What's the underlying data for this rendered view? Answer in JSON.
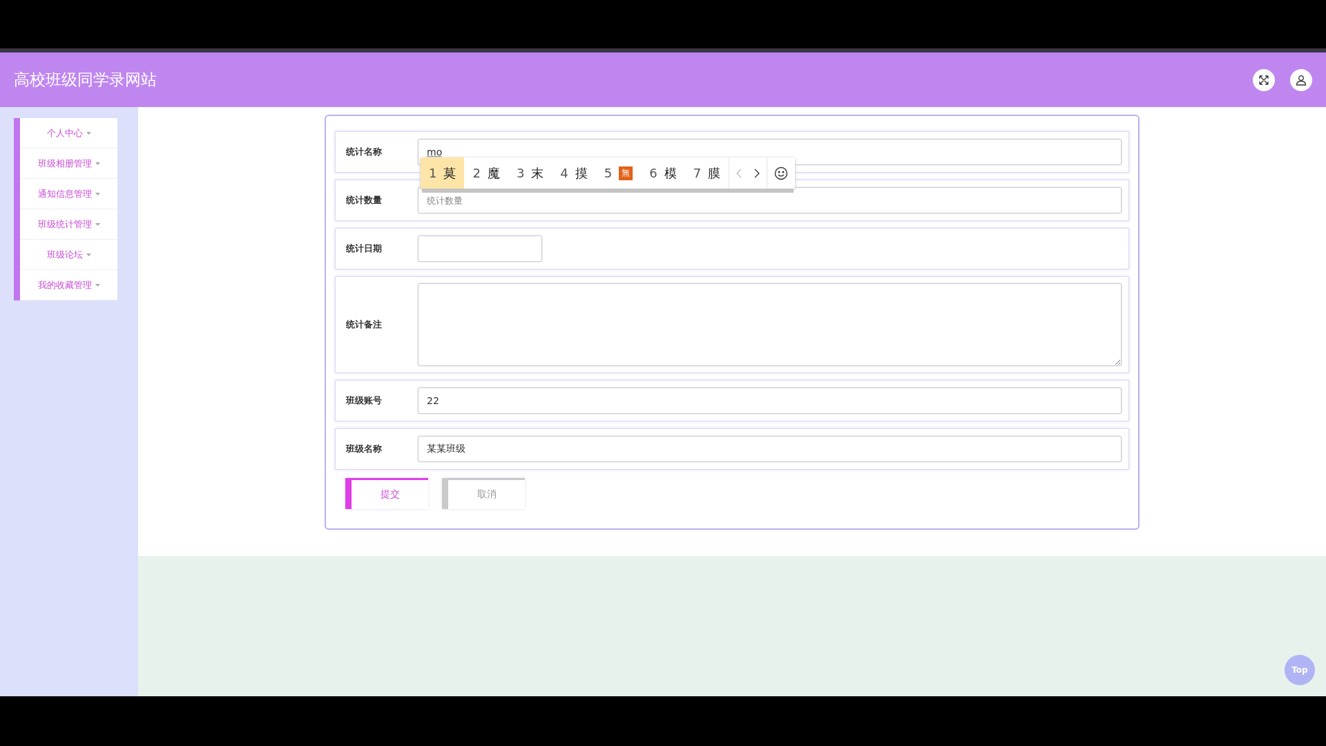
{
  "header": {
    "title": "高校班级同学录网站"
  },
  "sidebar": {
    "items": [
      {
        "label": "个人中心"
      },
      {
        "label": "班级相册管理"
      },
      {
        "label": "通知信息管理"
      },
      {
        "label": "班级统计管理"
      },
      {
        "label": "班级论坛"
      },
      {
        "label": "我的收藏管理"
      }
    ]
  },
  "form": {
    "fields": [
      {
        "kind": "text",
        "label": "统计名称",
        "value": "mo"
      },
      {
        "kind": "text",
        "label": "统计数量",
        "placeholder": "统计数量"
      },
      {
        "kind": "date",
        "label": "统计日期"
      },
      {
        "kind": "textarea",
        "label": "统计备注"
      },
      {
        "kind": "text",
        "label": "班级账号",
        "value": "22"
      },
      {
        "kind": "text",
        "label": "班级名称",
        "value": "某某班级"
      }
    ],
    "buttons": [
      {
        "kind": "primary",
        "label": "提交"
      },
      {
        "kind": "cancel",
        "label": "取消"
      }
    ]
  },
  "ime": {
    "candidates": [
      {
        "index": "1",
        "text": "莫",
        "kind": "char",
        "selected": true
      },
      {
        "index": "2",
        "text": "魔",
        "kind": "char",
        "selected": false
      },
      {
        "index": "3",
        "text": "末",
        "kind": "char",
        "selected": false
      },
      {
        "index": "4",
        "text": "摸",
        "kind": "char",
        "selected": false
      },
      {
        "index": "5",
        "text": "無",
        "kind": "emoji",
        "selected": false
      },
      {
        "index": "6",
        "text": "模",
        "kind": "char",
        "selected": false
      },
      {
        "index": "7",
        "text": "膜",
        "kind": "char",
        "selected": false
      }
    ]
  },
  "top_button": {
    "label": "Top"
  }
}
